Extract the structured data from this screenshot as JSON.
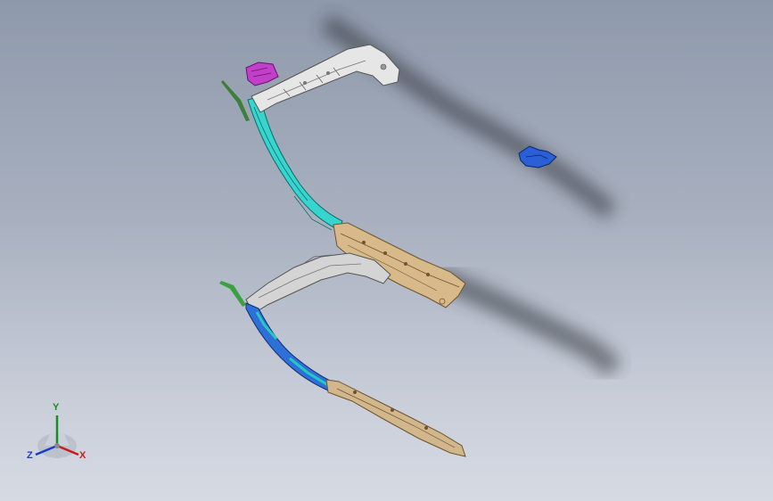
{
  "scene": {
    "background_top": "#8e99ab",
    "background_bottom": "#d6dae3",
    "parts": [
      {
        "name": "upper-roof-rail",
        "color": "#e6e6e6"
      },
      {
        "name": "upper-a-pillar",
        "color": "#36d6cf"
      },
      {
        "name": "upper-side-sill",
        "color": "#d8b98a"
      },
      {
        "name": "magenta-bracket",
        "color": "#c040c8"
      },
      {
        "name": "blue-bracket",
        "color": "#2a5fd6"
      },
      {
        "name": "lower-roof-rail",
        "color": "#d4d4d4"
      },
      {
        "name": "lower-a-pillar",
        "color": "#2f6fd8"
      },
      {
        "name": "lower-side-sill",
        "color": "#d2b68c"
      }
    ]
  },
  "triad": {
    "y_label": "Y",
    "z_label": "Z",
    "x_label": "X",
    "x_color": "#c81c1c",
    "y_color": "#1c8a2a",
    "z_color": "#1c3cc8"
  }
}
